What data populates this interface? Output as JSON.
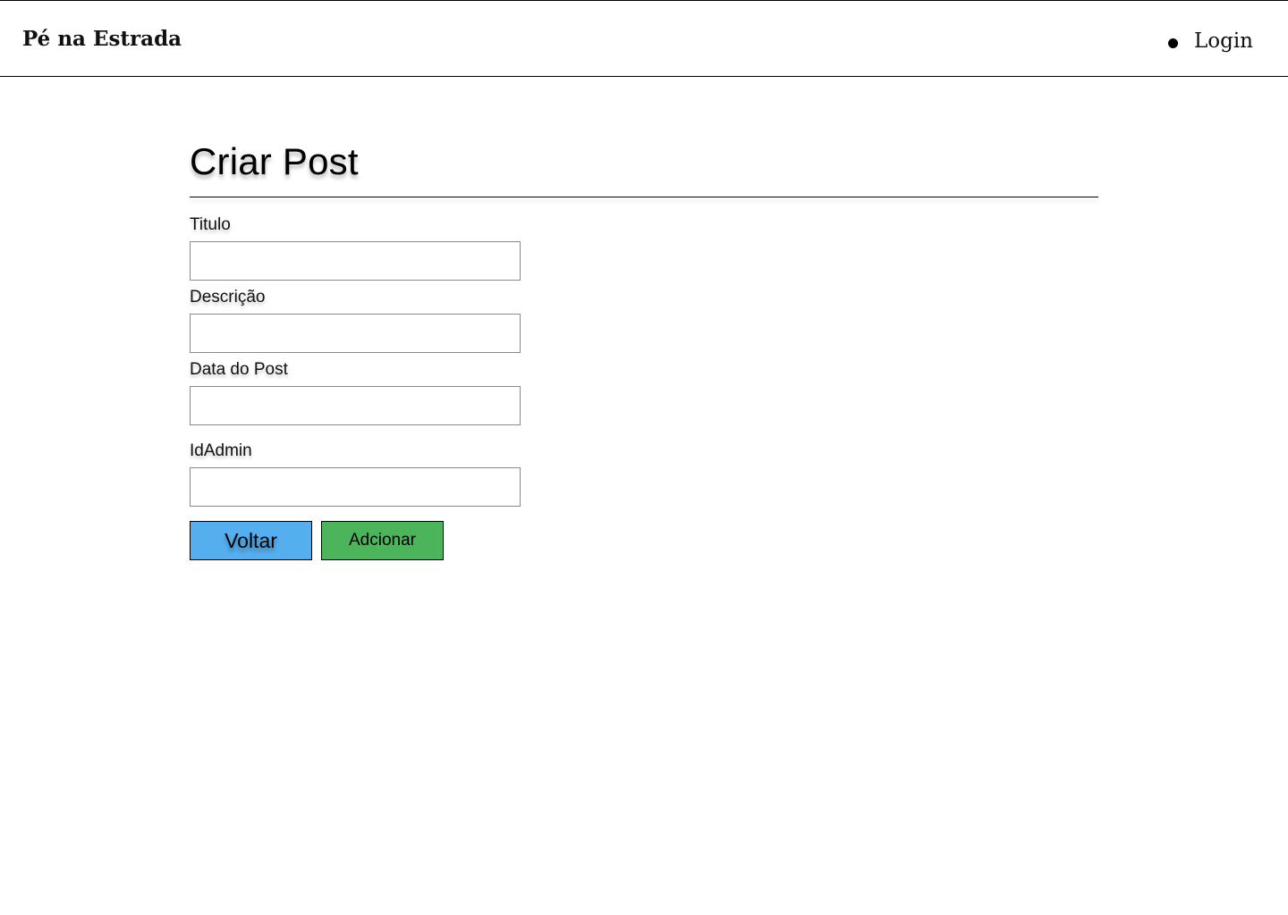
{
  "header": {
    "brand": "Pé na Estrada",
    "nav": {
      "login_label": "Login"
    }
  },
  "form": {
    "title": "Criar Post",
    "fields": [
      {
        "label": "Titulo",
        "value": "",
        "placeholder": ""
      },
      {
        "label": "Descrição",
        "value": "",
        "placeholder": ""
      },
      {
        "label": "Data do Post",
        "value": "",
        "placeholder": ""
      },
      {
        "label": "IdAdmin",
        "value": "",
        "placeholder": ""
      }
    ],
    "buttons": {
      "back_label": "Voltar",
      "add_label": "Adcionar"
    }
  },
  "colors": {
    "back_button": "#55aeee",
    "add_button": "#4cb55c"
  }
}
